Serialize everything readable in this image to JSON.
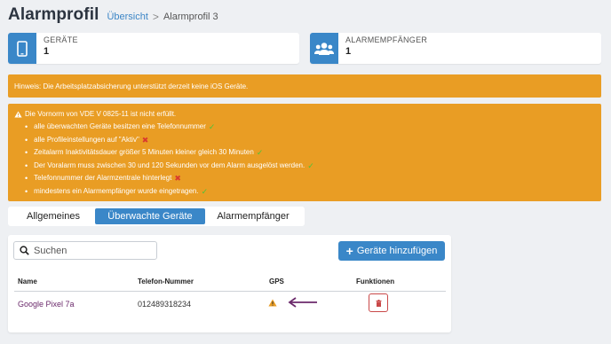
{
  "header": {
    "title": "Alarmprofil",
    "breadcrumb": {
      "link": "Übersicht",
      "separator": ">",
      "current": "Alarmprofil 3"
    }
  },
  "stats": [
    {
      "icon": "smartphone-icon",
      "label": "GERÄTE",
      "value": "1"
    },
    {
      "icon": "users-icon",
      "label": "ALARMEMPFÄNGER",
      "value": "1"
    }
  ],
  "notice": "Hinweis: Die Arbeitsplatzabsicherung unterstützt derzeit keine iOS Geräte.",
  "requirements": {
    "heading": "Die Vornorm von VDE V 0825-11 ist nicht erfüllt.",
    "items": [
      {
        "text": "alle überwachten Geräte besitzen eine Telefonnummer",
        "status": "ok"
      },
      {
        "text": "alle Profileinstellungen auf \"Aktiv\"",
        "status": "fail"
      },
      {
        "text": "Zeitalarm Inaktivitätsdauer größer 5 Minuten kleiner gleich 30 Minuten",
        "status": "ok"
      },
      {
        "text": "Der Voralarm muss zwischen 30 und 120 Sekunden vor dem Alarm ausgelöst werden.",
        "status": "ok"
      },
      {
        "text": "Telefonnummer der Alarmzentrale hinterlegt",
        "status": "fail"
      },
      {
        "text": "mindestens ein Alarmempfänger wurde eingetragen.",
        "status": "ok"
      }
    ],
    "ok_mark": "✓",
    "fail_mark": "✖"
  },
  "tabs": [
    {
      "label": "Allgemeines",
      "active": false
    },
    {
      "label": "Überwachte Geräte",
      "active": true
    },
    {
      "label": "Alarmempfänger",
      "active": false
    }
  ],
  "search": {
    "placeholder": "Suchen",
    "value": ""
  },
  "add_button": {
    "label": "Geräte hinzufügen",
    "icon": "plus-icon"
  },
  "table": {
    "columns": [
      "Name",
      "Telefon-Nummer",
      "GPS",
      "Funktionen"
    ],
    "rows": [
      {
        "name": "Google Pixel 7a",
        "phone": "012489318234",
        "gps": "warning-icon",
        "action": "trash-icon"
      }
    ]
  },
  "colors": {
    "primary": "#3a87c8",
    "warning_bg": "#e99d24",
    "ok": "#4cc33a",
    "fail": "#d93a2f",
    "arrow": "#6b2a6b",
    "delete_border": "#c94848"
  }
}
